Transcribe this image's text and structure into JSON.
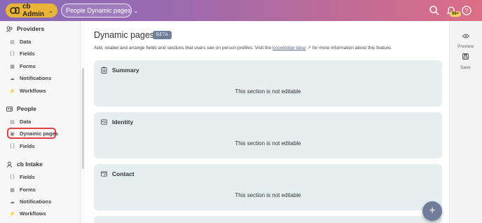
{
  "topbar": {
    "org_label": "cb Admin",
    "page_select": "People Dynamic pages",
    "notification_count": "99+",
    "colors": {
      "org_button": "#e9b43a",
      "gradient_start": "#8a6ab8",
      "gradient_end": "#dd6e86"
    }
  },
  "sidebar": {
    "providers": {
      "title": "Providers",
      "items": [
        {
          "label": "Data",
          "icon": "database-icon"
        },
        {
          "label": "Fields",
          "icon": "braces-icon"
        },
        {
          "label": "Forms",
          "icon": "form-icon"
        },
        {
          "label": "Notifications",
          "icon": "cloud-icon"
        },
        {
          "label": "Workflows",
          "icon": "workflow-icon"
        }
      ]
    },
    "people": {
      "title": "People",
      "items": [
        {
          "label": "Data",
          "icon": "database-icon"
        },
        {
          "label": "Dynamic pages",
          "icon": "page-icon",
          "selected": true
        },
        {
          "label": "Fields",
          "icon": "braces-icon"
        }
      ]
    },
    "intake": {
      "title": "cb Intake",
      "items": [
        {
          "label": "Fields",
          "icon": "braces-icon"
        },
        {
          "label": "Forms",
          "icon": "form-icon"
        },
        {
          "label": "Notifications",
          "icon": "cloud-icon"
        },
        {
          "label": "Workflows",
          "icon": "workflow-icon"
        }
      ]
    }
  },
  "main": {
    "title": "Dynamic pages",
    "badge": "BETA",
    "description_pre": "Add, relabel and arrange fields and sections that users see on person profiles. Visit the",
    "description_link": "knowledge base",
    "description_post": "for more information about this feature.",
    "sections": [
      {
        "title": "Summary",
        "body": "This section is not editable",
        "icon": "clipboard-icon"
      },
      {
        "title": "Identity",
        "body": "This section is not editable",
        "icon": "id-card-icon"
      },
      {
        "title": "Contact",
        "body": "This section is not editable",
        "icon": "contact-card-icon"
      }
    ]
  },
  "rail": {
    "preview": "Preview",
    "save": "Save"
  },
  "fab": {
    "label": "+"
  }
}
